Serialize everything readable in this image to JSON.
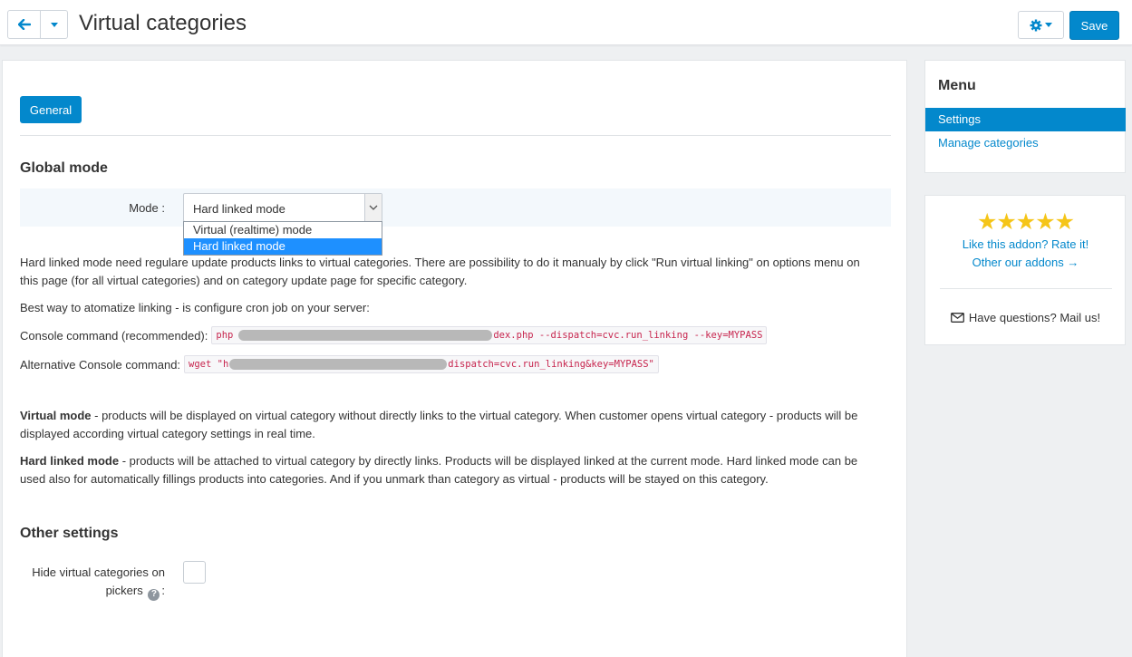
{
  "header": {
    "title": "Virtual categories",
    "save_label": "Save"
  },
  "tabs": [
    {
      "label": "General",
      "active": true
    }
  ],
  "global_mode": {
    "title": "Global mode",
    "mode_label": "Mode :",
    "mode_value": "Hard linked mode",
    "options": [
      "Virtual (realtime) mode",
      "Hard linked mode"
    ],
    "selected_option": "Hard linked mode"
  },
  "description": {
    "p1": "Hard linked mode need regulare update products links to virtual categories. There are possibility to do it manualy by click \"Run virtual linking\" on options menu on this page (for all virtual categories) and on category update page for specific category.",
    "p2": "Best way to atomatize linking - is configure cron job on your server:",
    "console_label": "Console command (recommended):",
    "console_cmd_start": "php",
    "console_cmd_end": "dex.php --dispatch=cvc.run_linking --key=MYPASS",
    "alt_label": "Alternative Console command:",
    "alt_cmd_start": "wget \"h",
    "alt_cmd_end": "dispatch=cvc.run_linking&key=MYPASS\"",
    "virtual_mode_title": "Virtual mode",
    "virtual_mode_text": " - products will be displayed on virtual category without directly links to the virtual category. When customer opens virtual category - products will be displayed according virtual category settings in real time.",
    "hard_mode_title": "Hard linked mode",
    "hard_mode_text": " - products will be attached to virtual category by directly links. Products will be displayed linked at the current mode. Hard linked mode can be used also for automatically fillings products into categories. And if you unmark than category as virtual - products will be stayed on this category."
  },
  "other_settings": {
    "title": "Other settings",
    "hide_label": "Hide virtual categories on pickers",
    "hide_colon": ":",
    "hide_checked": false
  },
  "sidebar": {
    "menu_title": "Menu",
    "items": [
      {
        "label": "Settings",
        "active": true
      },
      {
        "label": "Manage categories",
        "active": false
      }
    ]
  },
  "addon": {
    "stars": "★★★★★",
    "rating": 5,
    "rate_link": "Like this addon? Rate it!",
    "other_link": "Other our addons →",
    "mail_text": "Have questions? Mail us!"
  },
  "colors": {
    "accent": "#0388cc",
    "star": "#f5c518",
    "code_text": "#c7254e"
  }
}
